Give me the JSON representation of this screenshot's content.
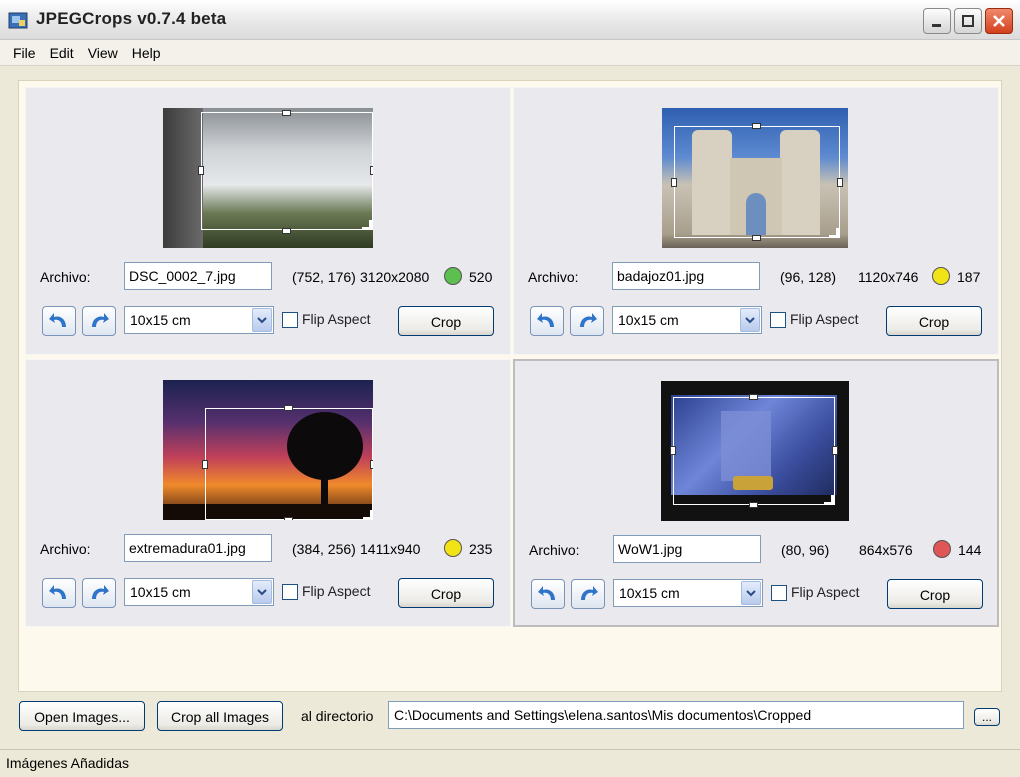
{
  "window": {
    "title": "JPEGCrops v0.7.4 beta"
  },
  "menu": [
    {
      "label": "File"
    },
    {
      "label": "Edit"
    },
    {
      "label": "View"
    },
    {
      "label": "Help"
    }
  ],
  "panels": [
    {
      "archivo_label": "Archivo:",
      "file": "DSC_0002_7.jpg",
      "coords": "(752, 176)",
      "dims": "3120x2080",
      "status_color": "#5cbf4f",
      "score": "520",
      "format": "10x15 cm",
      "flip_label": "Flip Aspect",
      "crop_label": "Crop",
      "flip_checked": false
    },
    {
      "archivo_label": "Archivo:",
      "file": "badajoz01.jpg",
      "coords": "(96, 128)",
      "dims": "1120x746",
      "status_color": "#f2e316",
      "score": "187",
      "format": "10x15 cm",
      "flip_label": "Flip Aspect",
      "crop_label": "Crop",
      "flip_checked": false
    },
    {
      "archivo_label": "Archivo:",
      "file": "extremadura01.jpg",
      "coords": "(384, 256)",
      "dims": "1411x940",
      "status_color": "#f2e316",
      "score": "235",
      "format": "10x15 cm",
      "flip_label": "Flip Aspect",
      "crop_label": "Crop",
      "flip_checked": false
    },
    {
      "archivo_label": "Archivo:",
      "file": "WoW1.jpg",
      "coords": "(80, 96)",
      "dims": "864x576",
      "status_color": "#e05555",
      "score": "144",
      "format": "10x15 cm",
      "flip_label": "Flip Aspect",
      "crop_label": "Crop",
      "flip_checked": false
    }
  ],
  "bottom": {
    "open_label": "Open Images...",
    "crop_all_label": "Crop all Images",
    "dir_label": "al directorio",
    "dir_value": "C:\\Documents and Settings\\elena.santos\\Mis documentos\\Cropped",
    "browse_label": "..."
  },
  "status": {
    "text": "Imágenes Añadidas"
  },
  "colors": {
    "xp_button_border": "#003c74",
    "panel_bg": "#e9e9ee",
    "client_bg": "#fdf9ec"
  }
}
